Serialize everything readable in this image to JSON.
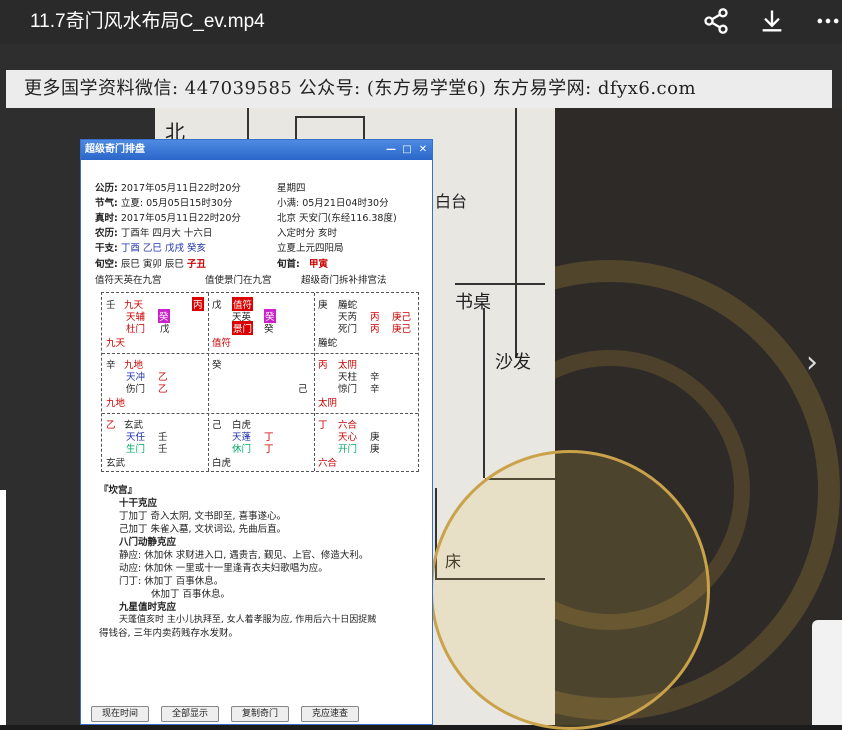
{
  "player": {
    "title": "11.7奇门风水布局C_ev.mp4",
    "share_icon": "share-icon",
    "download_icon": "download-icon",
    "more_icon": "more-icon",
    "next_icon": "chevron-right-icon"
  },
  "banner": {
    "text": "更多国学资料微信: 447039585 公众号: (东方易学堂6) 东方易学网: dfyx6.com"
  },
  "paper": {
    "hand1": "北",
    "hand2": "书桌",
    "hand3": "沙发",
    "hand4": "白台",
    "hand5": "床"
  },
  "app": {
    "title": "超级奇门排盘",
    "info": {
      "gongli_label": "公历:",
      "gongli_value": "2017年05月11日22时20分",
      "weekday": "星期四",
      "jieqi_label": "节气:",
      "jieqi_value": "立夏: 05月05日15时30分",
      "xiaoman": "小满: 05月21日04时30分",
      "zhenshi_label": "真时:",
      "zhenshi_value": "2017年05月11日22时20分",
      "location": "北京 天安门(东经116.38度)",
      "nongli_label": "农历:",
      "nongli_value": "丁酉年  四月大  十六日",
      "rujing": "入定时分  亥时",
      "ganzhi_label": "干支:",
      "ganzhi_year": "丁酉",
      "ganzhi_month": "乙巳",
      "ganzhi_day": "戊戌",
      "ganzhi_hour": "癸亥",
      "ju": "立夏上元四阳局",
      "xunkong_label": "旬空:",
      "xunkong_values": "辰巳  寅卯  辰巳",
      "xunkong_zi": "子丑",
      "xunshou_label": "旬首:",
      "xunshou_value": "甲寅",
      "zhifu": "值符天英在九宫",
      "zhishi": "值使景门在九宫",
      "method": "超级奇门拆补排宫法"
    },
    "palaces": {
      "p4": {
        "a": "壬",
        "b": "九天",
        "c": "天辅",
        "d": "杜门",
        "e": "戊",
        "f": "九天",
        "g": "丙"
      },
      "p9": {
        "a": "戊",
        "b": "值符",
        "c": "天英",
        "d": "景门",
        "e": "值符",
        "f": "癸",
        "g": "癸"
      },
      "p2": {
        "a": "庚",
        "b": "螣蛇",
        "c": "天芮",
        "d": "死门",
        "e": "丙",
        "f": "丙",
        "g": "螣蛇",
        "h": "庚己",
        "i": "庚己"
      },
      "p3": {
        "a": "辛",
        "b": "九地",
        "c": "天冲",
        "d": "伤门",
        "e": "乙",
        "f": "乙",
        "g": "九地"
      },
      "p5": {
        "a": "癸",
        "b": "己"
      },
      "p7": {
        "a": "丙",
        "b": "太阴",
        "c": "天柱",
        "d": "惊门",
        "e": "辛",
        "f": "辛",
        "g": "太阴"
      },
      "p8": {
        "a": "乙",
        "b": "玄武",
        "c": "天任",
        "d": "生门",
        "e": "壬",
        "f": "壬",
        "g": "玄武"
      },
      "p1": {
        "a": "己",
        "b": "白虎",
        "c": "天蓬",
        "d": "休门",
        "e": "丁",
        "f": "丁",
        "g": "白虎"
      },
      "p6": {
        "a": "丁",
        "b": "六合",
        "c": "天心",
        "d": "开门",
        "e": "庚",
        "f": "庚",
        "g": "六合"
      }
    },
    "detail": {
      "palace_title": "『坎宫』",
      "s1": "十干克应",
      "s1_l1": "丁加丁   奇入太阴, 文书即至, 喜事遂心。",
      "s1_l2": "己加丁   朱雀入墓, 文状词讼, 先曲后直。",
      "s2": "八门动静克应",
      "s2_l1": "静应: 休加休   求财进入口, 遇贵吉, 觐见、上官、修造大利。",
      "s2_l2": "动应: 休加休   一里或十一里逢青衣夫妇歌唱为应。",
      "s2_l3": "门丁: 休加丁   百事休息。",
      "s2_l4": "休加丁   百事休息。",
      "s3": "九星值时克应",
      "s3_l1": "天蓬值亥时   主小儿执拜至, 女人着孝服为应, 作用后六十日因捉贼",
      "s3_l2": "得钱谷, 三年内卖药贱存水发财。"
    },
    "buttons": {
      "now": "现在时间",
      "all": "全部显示",
      "copy": "复制奇门",
      "keying": "克应速查"
    }
  }
}
